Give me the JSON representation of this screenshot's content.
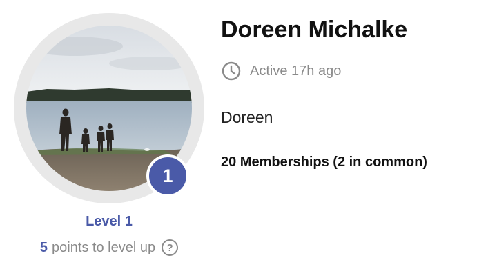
{
  "profile": {
    "name": "Doreen Michalke",
    "active": "Active 17h ago",
    "bio": "Doreen",
    "memberships": "20 Memberships (2 in common)",
    "avatar_icon": "profile-photo",
    "clock_icon": "clock-icon"
  },
  "level": {
    "badge_number": "1",
    "label": "Level 1",
    "points": "5",
    "points_text": "points to level up",
    "help_icon": "?"
  },
  "colors": {
    "accent": "#4a5aa8",
    "muted_text": "#8a8a8a",
    "ring": "#e8e8e8"
  }
}
